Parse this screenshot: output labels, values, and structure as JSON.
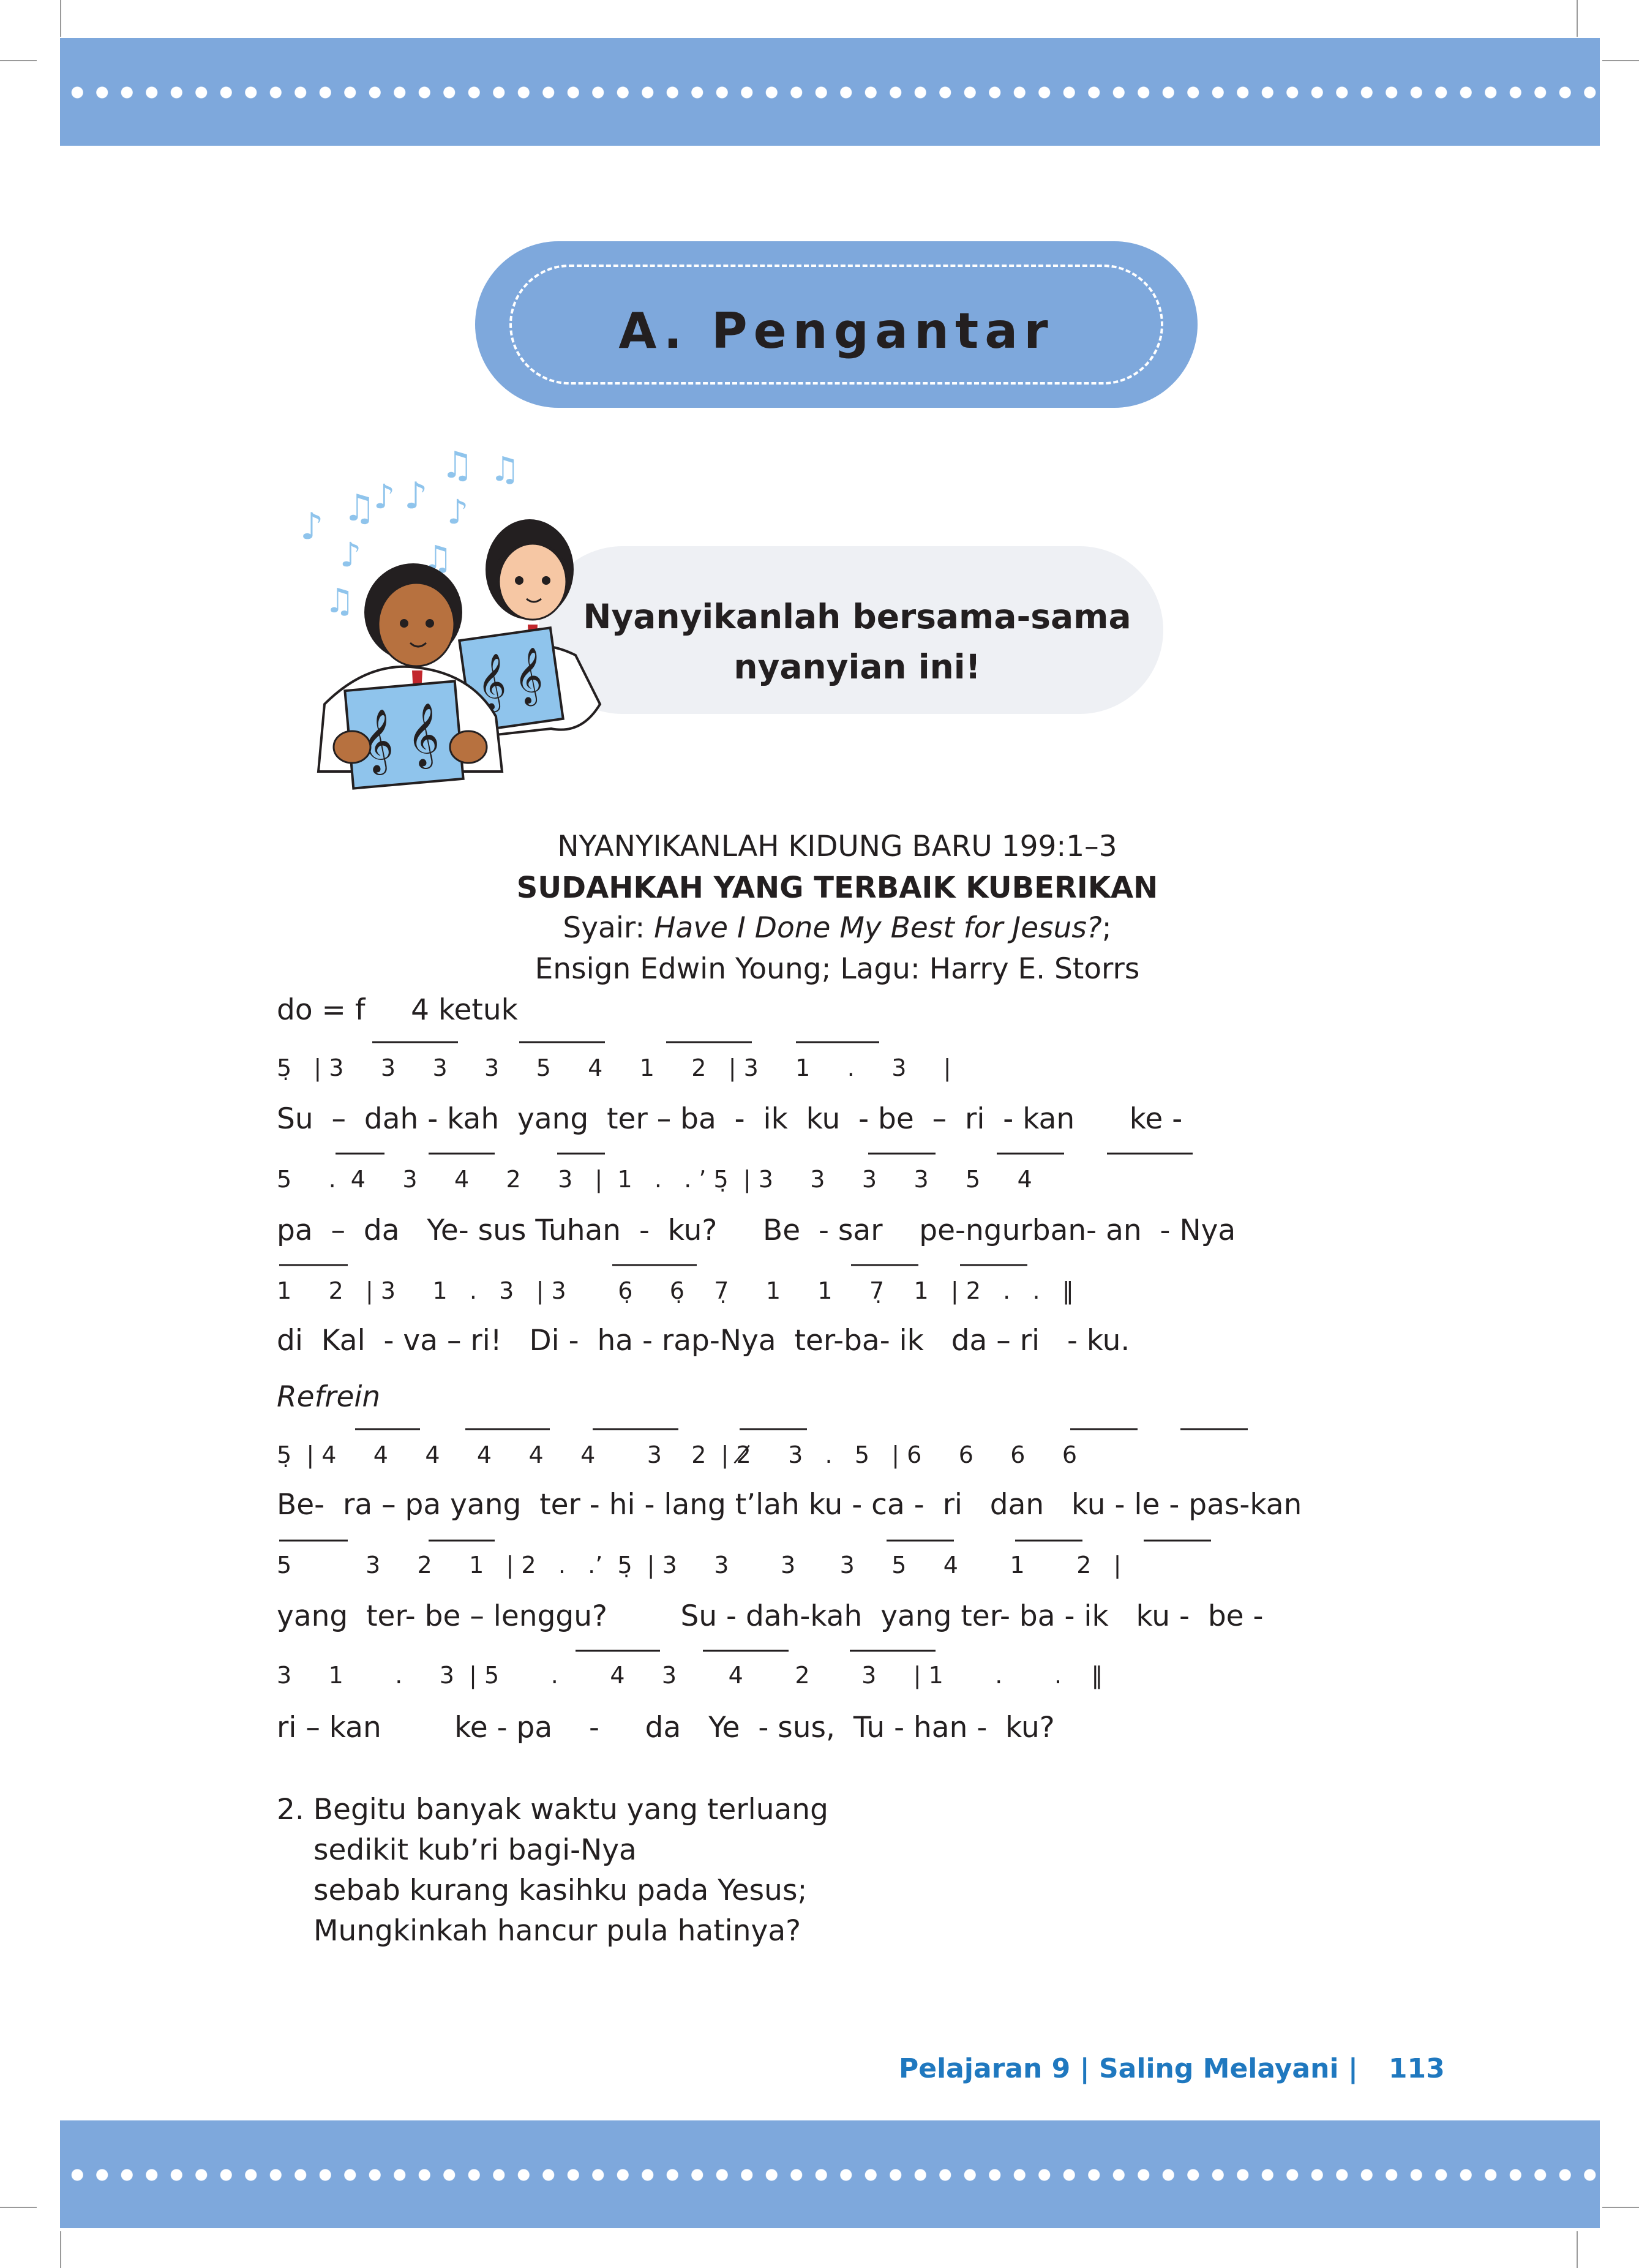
{
  "section": {
    "title": "A. Pengantar"
  },
  "instruction": {
    "line1": "Nyanyikanlah bersama-sama",
    "line2": "nyanyian ini!"
  },
  "song": {
    "source": "NYANYIKANLAH KIDUNG BARU 199:1–3",
    "title": "SUDAHKAH YANG TERBAIK KUBERIKAN",
    "credit_prefix": "Syair: ",
    "credit_original": "Have I Done My Best for Jesus?",
    "credit_suffix": ";",
    "credit_line2": "Ensign Edwin Young; Lagu: Harry E. Storrs",
    "key": "do = f     4 ketuk",
    "notation": [
      "5̣   | 3     3     3     3     5     4     1     2   | 3     1     .     3     |",
      "5     .  4     3     4     2     3   |  1   .   . ’ 5̣  | 3     3     3     3     5     4",
      "1     2   | 3     1   .   3   | 3       6̣     6̣    7̣     1     1     7̣    1   | 2   .   .   ‖",
      "5̣  | 4     4     4     4     4     4       3    2  | 2̸     3   .   5   | 6     6     6     6",
      "5          3     2     1   | 2   .   .’  5̣  | 3     3       3      3     5     4       1       2   |",
      "3     1       .     3  | 5       .       4     3       4       2       3     | 1       .       .    ‖"
    ],
    "lyrics": [
      "Su  –  dah - kah  yang  ter – ba  -  ik  ku  - be  –  ri  - kan      ke -",
      "pa  –  da   Ye- sus Tuhan  -  ku?     Be  - sar    pe-ngurban- an  - Nya",
      "di  Kal  - va – ri!   Di -  ha - rap-Nya  ter-ba- ik   da – ri   - ku.",
      "Be-  ra – pa yang  ter - hi - lang t’lah ku - ca -  ri   dan   ku - le - pas-kan",
      "yang  ter- be – lenggu?        Su - dah-kah  yang ter- ba - ik   ku -  be -",
      "ri – kan        ke - pa    -     da   Ye  - sus,  Tu - han -  ku?"
    ],
    "refrain_label": "Refrein"
  },
  "verse2": [
    "2. Begitu banyak waktu yang terluang",
    "sedikit kub’ri bagi-Nya",
    "sebab kurang kasihku pada Yesus;",
    "Mungkinkah hancur pula hatinya?"
  ],
  "footer": {
    "text": "Pelajaran 9 | Saling Melayani |",
    "page": "113"
  },
  "colors": {
    "band": "#7ea8dc",
    "footer": "#1f78bf",
    "note_icons": "#8fc4ec"
  }
}
